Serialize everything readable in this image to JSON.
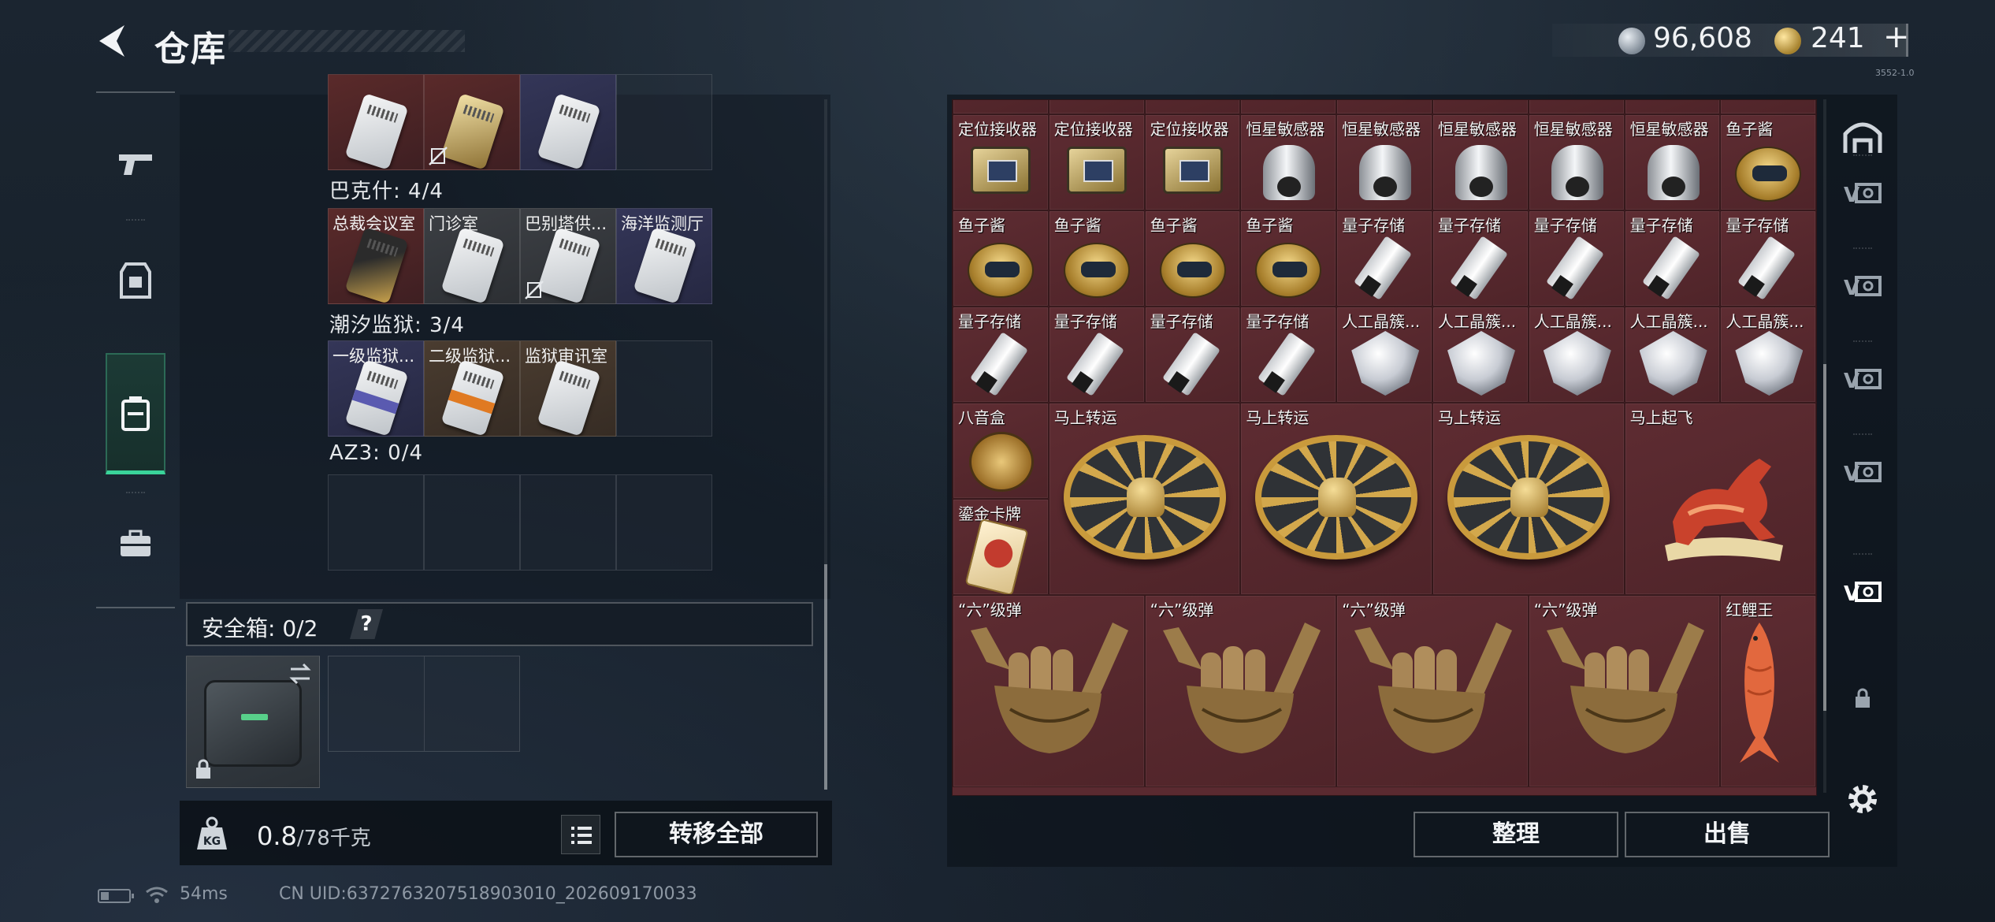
{
  "header": {
    "title": "仓库",
    "currency_silver": "96,608",
    "currency_gold": "241",
    "add_label": "+",
    "version": "3552-1.0"
  },
  "left_nav": {
    "items": [
      "weapon-icon",
      "armor-icon",
      "backpack-icon",
      "toolbox-icon"
    ],
    "active": "backpack-icon"
  },
  "inventory": {
    "top_row": [
      {
        "label": "",
        "card": "white",
        "bg": "red",
        "no_trade": false
      },
      {
        "label": "",
        "card": "gold",
        "bg": "red",
        "no_trade": true
      },
      {
        "label": "",
        "card": "white",
        "bg": "navy",
        "no_trade": false
      },
      {
        "label": "",
        "card": "",
        "bg": "empty",
        "no_trade": false
      }
    ],
    "sections": [
      {
        "title": "巴克什: 4/4",
        "cards": [
          {
            "label": "总裁会议室",
            "card": "blackgold",
            "bg": "red",
            "no_trade": false
          },
          {
            "label": "门诊室",
            "card": "white",
            "bg": "gray",
            "no_trade": false
          },
          {
            "label": "巴别塔供...",
            "card": "white",
            "bg": "gray",
            "no_trade": true
          },
          {
            "label": "海洋监测厅",
            "card": "white",
            "bg": "navy",
            "no_trade": false
          }
        ]
      },
      {
        "title": "潮汐监狱: 3/4",
        "cards": [
          {
            "label": "一级监狱...",
            "card": "purple",
            "bg": "navy",
            "no_trade": false
          },
          {
            "label": "二级监狱...",
            "card": "orange",
            "bg": "brown",
            "no_trade": false
          },
          {
            "label": "监狱审讯室",
            "card": "white",
            "bg": "brown",
            "no_trade": false
          },
          {
            "label": "",
            "card": "",
            "bg": "empty",
            "no_trade": false
          }
        ]
      },
      {
        "title": "AZ3: 0/4",
        "cards": [
          {
            "label": "",
            "card": "",
            "bg": "empty",
            "no_trade": false
          },
          {
            "label": "",
            "card": "",
            "bg": "empty",
            "no_trade": false
          },
          {
            "label": "",
            "card": "",
            "bg": "empty",
            "no_trade": false
          },
          {
            "label": "",
            "card": "",
            "bg": "empty",
            "no_trade": false
          }
        ]
      }
    ]
  },
  "safe_box": {
    "label": "安全箱: 0/2",
    "help": "?"
  },
  "bottom_left": {
    "weight_value": "0.8",
    "weight_max": "/78千克",
    "transfer_all": "转移全部"
  },
  "status": {
    "ping": "54ms",
    "uid": "CN UID:6372763207518903010_202609170033"
  },
  "stash_grid": {
    "rows": [
      [
        {
          "label": "定位接收器",
          "art": "receiver"
        },
        {
          "label": "定位接收器",
          "art": "receiver"
        },
        {
          "label": "定位接收器",
          "art": "receiver"
        },
        {
          "label": "恒星敏感器",
          "art": "sensor"
        },
        {
          "label": "恒星敏感器",
          "art": "sensor"
        },
        {
          "label": "恒星敏感器",
          "art": "sensor"
        },
        {
          "label": "恒星敏感器",
          "art": "sensor"
        },
        {
          "label": "恒星敏感器",
          "art": "sensor"
        },
        {
          "label": "鱼子酱",
          "art": "caviar"
        }
      ],
      [
        {
          "label": "鱼子酱",
          "art": "caviar"
        },
        {
          "label": "鱼子酱",
          "art": "caviar"
        },
        {
          "label": "鱼子酱",
          "art": "caviar"
        },
        {
          "label": "鱼子酱",
          "art": "caviar"
        },
        {
          "label": "量子存储",
          "art": "usb"
        },
        {
          "label": "量子存储",
          "art": "usb"
        },
        {
          "label": "量子存储",
          "art": "usb"
        },
        {
          "label": "量子存储",
          "art": "usb"
        },
        {
          "label": "量子存储",
          "art": "usb"
        }
      ],
      [
        {
          "label": "量子存储",
          "art": "usb"
        },
        {
          "label": "量子存储",
          "art": "usb"
        },
        {
          "label": "量子存储",
          "art": "usb"
        },
        {
          "label": "量子存储",
          "art": "usb"
        },
        {
          "label": "人工晶簇...",
          "art": "crystal"
        },
        {
          "label": "人工晶簇...",
          "art": "crystal"
        },
        {
          "label": "人工晶簇...",
          "art": "crystal"
        },
        {
          "label": "人工晶簇...",
          "art": "crystal"
        },
        {
          "label": "人工晶簇...",
          "art": "crystal"
        }
      ]
    ],
    "small_items": [
      {
        "label": "八音盒",
        "art": "musicbox"
      },
      {
        "label": "鎏金卡牌",
        "art": "goldcard"
      }
    ],
    "wheels": [
      {
        "label": "马上转运",
        "art": "wheel"
      },
      {
        "label": "马上转运",
        "art": "wheel"
      },
      {
        "label": "马上转运",
        "art": "wheel"
      },
      {
        "label": "马上起飞",
        "art": "horse"
      }
    ],
    "bullets": [
      {
        "label": "“六”级弹",
        "art": "hand"
      },
      {
        "label": "“六”级弹",
        "art": "hand"
      },
      {
        "label": "“六”级弹",
        "art": "hand"
      },
      {
        "label": "“六”级弹",
        "art": "hand"
      }
    ],
    "fish": {
      "label": "红鲤王",
      "art": "fish"
    }
  },
  "bottom_right": {
    "sort": "整理",
    "sell": "出售"
  },
  "right_nav": {
    "items": [
      "home-icon",
      "storage-tab-icon",
      "storage-tab-icon",
      "storage-tab-icon",
      "storage-tab-icon",
      "storage-tab-icon",
      "lock-icon",
      "settings-icon"
    ],
    "active_index": 5
  },
  "colors": {
    "accent_green": "#3ad39a",
    "grid_bg": "#5a2a30",
    "gold": "#c99a3c"
  }
}
